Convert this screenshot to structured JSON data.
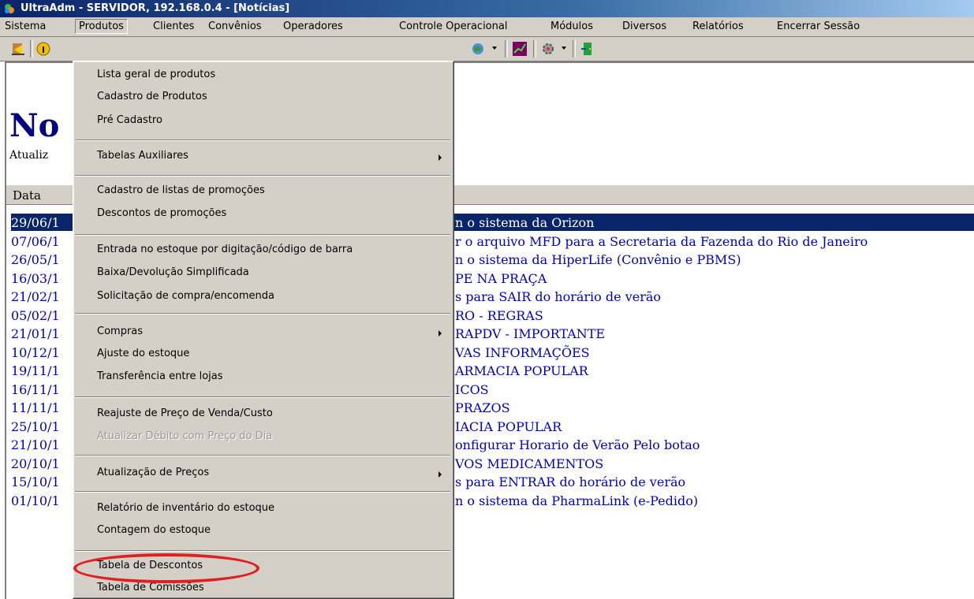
{
  "window": {
    "title": "UltraAdm - SERVIDOR, 192.168.0.4 - [Notícias]",
    "accent": "#0a246a"
  },
  "menubar": {
    "items": [
      "Sistema",
      "Produtos",
      "Clientes",
      "Convênios",
      "Operadores",
      "Controle Operacional",
      "Módulos",
      "Diversos",
      "Relatórios",
      "Encerrar Sessão"
    ],
    "active": "Produtos"
  },
  "toolbar": {
    "icons": [
      "exit-icon",
      "info-icon",
      "globe-icon",
      "chart-icon",
      "gear-icon",
      "door-icon"
    ]
  },
  "page": {
    "heading": "No",
    "subheading": "Atualiz",
    "column_header": "Data"
  },
  "news": [
    {
      "date": "29/06/1",
      "title": "n o sistema da Orizon",
      "selected": true
    },
    {
      "date": "07/06/1",
      "title": "r o arquivo MFD para a Secretaria da Fazenda do Rio de Janeiro"
    },
    {
      "date": "26/05/1",
      "title": "n o sistema da HiperLife (Convênio e PBMS)"
    },
    {
      "date": "16/03/1",
      "title": "PE NA PRAÇA"
    },
    {
      "date": "21/02/1",
      "title": "s para SAIR do horário de verão"
    },
    {
      "date": "05/02/1",
      "title": "RO - REGRAS"
    },
    {
      "date": "21/01/1",
      "title": "RAPDV - IMPORTANTE"
    },
    {
      "date": "10/12/1",
      "title": "VAS INFORMAÇÕES"
    },
    {
      "date": "19/11/1",
      "title": "ARMACIA POPULAR"
    },
    {
      "date": "16/11/1",
      "title": "ICOS"
    },
    {
      "date": "11/11/1",
      "title": "PRAZOS"
    },
    {
      "date": "25/10/1",
      "title": "IACIA POPULAR"
    },
    {
      "date": "21/10/1",
      "title": "onfigurar Horario de Verão Pelo botao"
    },
    {
      "date": "20/10/1",
      "title": "VOS MEDICAMENTOS"
    },
    {
      "date": "15/10/1",
      "title": "s para ENTRAR do horário de verão"
    },
    {
      "date": "01/10/1",
      "title": "n o sistema da PharmaLink (e-Pedido)"
    }
  ],
  "dropdown": {
    "items": [
      "Lista geral de produtos",
      "Cadastro de Produtos",
      "Pré Cadastro",
      "Tabelas Auxiliares",
      "Cadastro de listas de promoções",
      "Descontos de promoções",
      "Entrada no estoque por digitação/código de barra",
      "Baixa/Devolução Simplificada",
      "Solicitação de compra/encomenda",
      "Compras",
      "Ajuste do estoque",
      "Transferência entre lojas",
      "Reajuste de Preço de Venda/Custo",
      "Atualizar Débito com Preço do Dia",
      "Atualização de Preços",
      "Relatório de inventário do estoque",
      "Contagem do estoque",
      "Tabela de Descontos",
      "Tabela de Comissões"
    ],
    "disabled": [
      "Atualizar Débito com Preço do Dia"
    ],
    "with_submenu": [
      "Tabelas Auxiliares",
      "Compras",
      "Atualização de Preços"
    ],
    "highlighted": "Tabela de Descontos"
  },
  "colors": {
    "highlight_ring": "#e02020",
    "link": "#0000cc",
    "selection": "#0a246a"
  }
}
